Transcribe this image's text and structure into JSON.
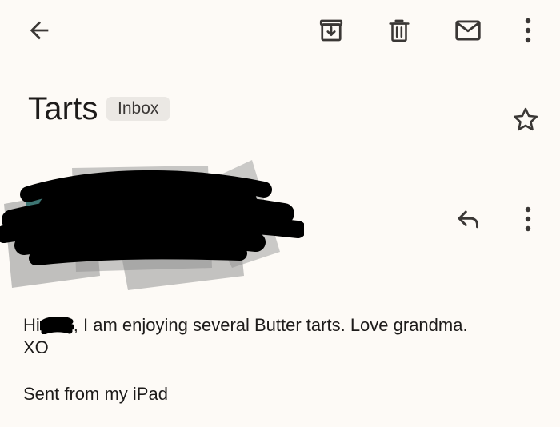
{
  "toolbar": {
    "icons": [
      "back-arrow-icon",
      "archive-icon",
      "delete-icon",
      "mark-unread-icon",
      "more-vert-icon"
    ]
  },
  "email": {
    "subject": "Tarts",
    "label": "Inbox",
    "body": {
      "greeting": "Hi",
      "line1_rest": ", I am enjoying several Butter tarts. Love grandma.",
      "line2": "XO"
    },
    "signature": "Sent from my iPad"
  },
  "colors": {
    "background": "#fdfaf6",
    "text": "#1d1b1a",
    "icon": "#3a3735",
    "badge_bg": "#ebe8e4",
    "redaction": "#000000"
  }
}
